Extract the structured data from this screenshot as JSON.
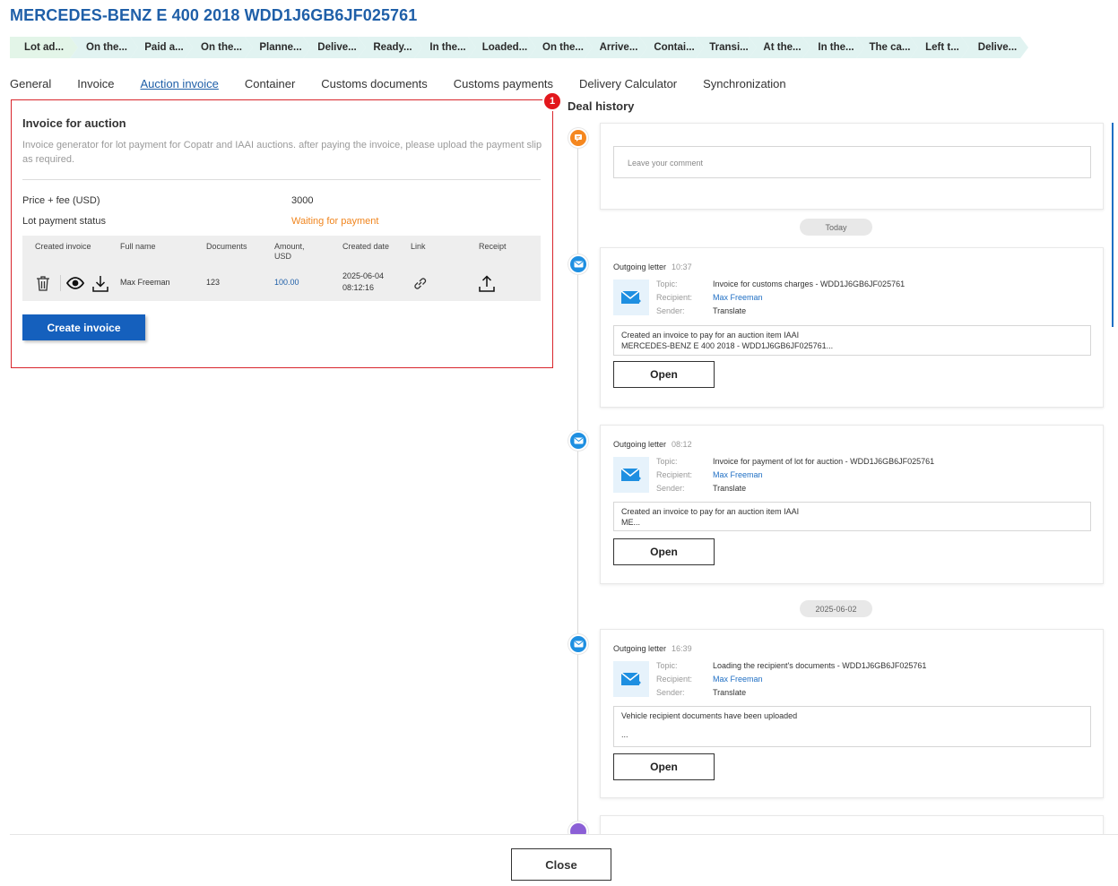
{
  "header": {
    "title": "MERCEDES-BENZ E 400 2018 WDD1J6GB6JF025761"
  },
  "stages": [
    {
      "label": "Lot ad...",
      "color": "#e3f5e8"
    },
    {
      "label": "On the...",
      "color": "#e1f3f1"
    },
    {
      "label": "Paid a...",
      "color": "#e1f3f1"
    },
    {
      "label": "On the...",
      "color": "#e1f3f1"
    },
    {
      "label": "Planne...",
      "color": "#e1f3f1"
    },
    {
      "label": "Delive...",
      "color": "#e1f3f1"
    },
    {
      "label": "Ready...",
      "color": "#e1f3f1"
    },
    {
      "label": "In the...",
      "color": "#e1f3f1"
    },
    {
      "label": "Loaded...",
      "color": "#e1f3f1"
    },
    {
      "label": "On the...",
      "color": "#e1f3f1"
    },
    {
      "label": "Arrive...",
      "color": "#e1f3f1"
    },
    {
      "label": "Contai...",
      "color": "#e1f3f1"
    },
    {
      "label": "Transi...",
      "color": "#e1f3f1"
    },
    {
      "label": "At the...",
      "color": "#e1f3f1"
    },
    {
      "label": "In the...",
      "color": "#e1f3f1"
    },
    {
      "label": "The ca...",
      "color": "#e1f3f1"
    },
    {
      "label": "Left t...",
      "color": "#e1f3f1"
    },
    {
      "label": "Delive...",
      "color": "#e1f3f1"
    }
  ],
  "tabs": [
    "General",
    "Invoice",
    "Auction invoice",
    "Container",
    "Customs documents",
    "Customs payments",
    "Delivery Calculator",
    "Synchronization"
  ],
  "active_tab": "Auction invoice",
  "annotation_badge": "1",
  "auction_invoice": {
    "title": "Invoice for auction",
    "description": "Invoice generator for lot payment for Copatr and IAAI auctions. after paying the invoice, please upload the payment slip as required.",
    "price_label": "Price + fee (USD)",
    "price_value": "3000",
    "status_label": "Lot payment status",
    "status_value": "Waiting for payment",
    "status_color": "#f0851e",
    "table": {
      "headers": {
        "created_invoice": "Created invoice",
        "full_name": "Full name",
        "documents": "Documents",
        "amount": "Amount, USD",
        "created_date": "Created date",
        "link": "Link",
        "receipt": "Receipt"
      },
      "row": {
        "full_name": "Max Freeman",
        "documents": "123",
        "amount": "100.00",
        "created_date": "2025-06-04 08:12:16",
        "icons": [
          "trash-icon",
          "eye-icon",
          "download-icon",
          "link-icon",
          "upload-icon"
        ]
      }
    },
    "create_button": "Create invoice"
  },
  "deal_history": {
    "title": "Deal history",
    "comment_placeholder": "Leave your comment",
    "today_label": "Today",
    "date_label": "2025-06-02",
    "letters": [
      {
        "type": "Outgoing letter",
        "time": "10:37",
        "topic_label": "Topic:",
        "topic": "Invoice for customs charges - WDD1J6GB6JF025761",
        "recipient_label": "Recipient:",
        "recipient": "Max Freeman",
        "sender_label": "Sender:",
        "sender": "Translate",
        "message_line1": "Created an invoice to pay for an auction item IAAI",
        "message_line2": "MERCEDES-BENZ E 400 2018 - WDD1J6GB6JF025761...",
        "open_label": "Open"
      },
      {
        "type": "Outgoing letter",
        "time": "08:12",
        "topic_label": "Topic:",
        "topic": "Invoice for payment of lot for auction - WDD1J6GB6JF025761",
        "recipient_label": "Recipient:",
        "recipient": "Max Freeman",
        "sender_label": "Sender:",
        "sender": "Translate",
        "message_line1": "Created an invoice to pay for an auction item IAAI",
        "message_line2": "ME...",
        "open_label": "Open"
      },
      {
        "type": "Outgoing letter",
        "time": "16:39",
        "topic_label": "Topic:",
        "topic": "Loading the recipient's documents - WDD1J6GB6JF025761",
        "recipient_label": "Recipient:",
        "recipient": "Max Freeman",
        "sender_label": "Sender:",
        "sender": "Translate",
        "message_line1": "Vehicle recipient documents have been uploaded",
        "message_line2": "...",
        "open_label": "Open"
      }
    ]
  },
  "footer": {
    "close_label": "Close"
  }
}
